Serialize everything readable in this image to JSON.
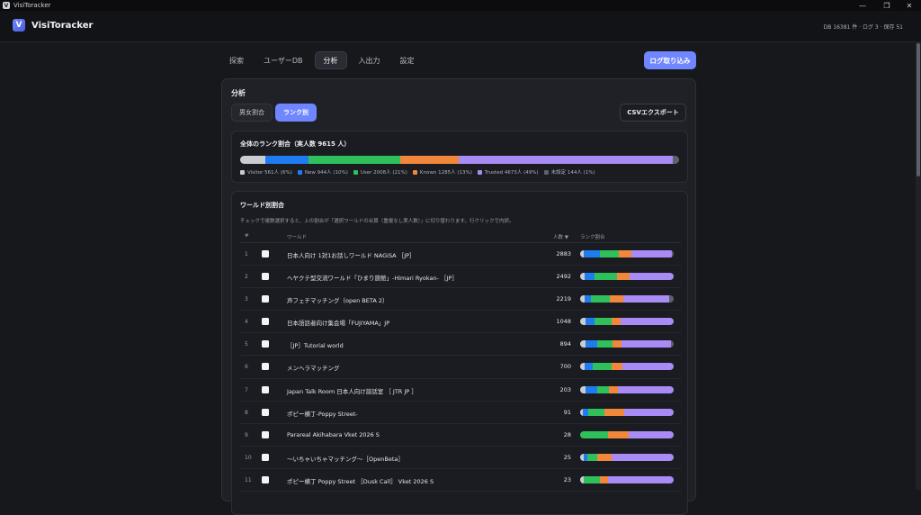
{
  "window": {
    "title": "VisiToracker",
    "minimize": "—",
    "maximize": "❐",
    "close": "✕",
    "app_icon": "V"
  },
  "header": {
    "logo": "V",
    "brand": "VisiToracker",
    "db_status": "DB 16381 件 · ログ 3 · 保存 51"
  },
  "nav": {
    "tabs": [
      {
        "label": "探索",
        "active": false
      },
      {
        "label": "ユーザーDB",
        "active": false
      },
      {
        "label": "分析",
        "active": true
      },
      {
        "label": "入出力",
        "active": false
      },
      {
        "label": "設定",
        "active": false
      }
    ],
    "import_label": "ログ取り込み"
  },
  "analysis": {
    "title": "分析",
    "subtabs": [
      {
        "label": "男女割合",
        "active": false
      },
      {
        "label": "ランク別",
        "active": true
      }
    ],
    "csv_label": "CSVエクスポート",
    "overall": {
      "title": "全体のランク割合（実人数 9615 人）",
      "segments": [
        {
          "label": "Visitor 561人 (6%)",
          "ratio": 0.058,
          "color": "#c9ccd2"
        },
        {
          "label": "New 944人 (10%)",
          "ratio": 0.098,
          "color": "#1f7cf0"
        },
        {
          "label": "User 2008人 (21%)",
          "ratio": 0.209,
          "color": "#2fbf5b"
        },
        {
          "label": "Known 1285人 (13%)",
          "ratio": 0.134,
          "color": "#f0873a"
        },
        {
          "label": "Trusted 4673人 (49%)",
          "ratio": 0.486,
          "color": "#a98bf5"
        },
        {
          "label": "未設定 144人 (1%)",
          "ratio": 0.015,
          "color": "#5d616b"
        }
      ]
    },
    "worlds": {
      "title": "ワールド別割合",
      "hint": "チェックで複数選択すると、上の割合が「選択ワールドの合算（重複なし実人数）」に切り替わります。行クリックで内訳。",
      "columns": {
        "index": "#",
        "world": "ワールド",
        "count": "人数 ▼",
        "rank": "ランク割合"
      },
      "rows": [
        {
          "index": "1",
          "name": "日本人向け 1対1お話しワールド NAGiSA ［JP］",
          "count": "2883",
          "ratios": [
            0.04,
            0.17,
            0.2,
            0.14,
            0.43,
            0.02
          ]
        },
        {
          "index": "2",
          "name": "ヘヤクテ型交流ワールド「ひまり旅館」-Himari Ryokan- ［JP］",
          "count": "2492",
          "ratios": [
            0.05,
            0.1,
            0.24,
            0.14,
            0.47,
            0.0
          ]
        },
        {
          "index": "3",
          "name": "声フェチマッチング（open BETA 2）",
          "count": "2219",
          "ratios": [
            0.05,
            0.07,
            0.2,
            0.14,
            0.49,
            0.05
          ]
        },
        {
          "index": "4",
          "name": "日本語話者向け集会場「FUJIYAMA」JP",
          "count": "1048",
          "ratios": [
            0.06,
            0.09,
            0.19,
            0.09,
            0.57,
            0.0
          ]
        },
        {
          "index": "5",
          "name": "［JP］Tutorial world",
          "count": "894",
          "ratios": [
            0.06,
            0.12,
            0.17,
            0.09,
            0.53,
            0.03
          ]
        },
        {
          "index": "6",
          "name": "メンヘラマッチング",
          "count": "700",
          "ratios": [
            0.05,
            0.08,
            0.21,
            0.11,
            0.55,
            0.0
          ]
        },
        {
          "index": "7",
          "name": "Japan Talk Room 日本人向け談話室 ［ JTR JP ］",
          "count": "203",
          "ratios": [
            0.06,
            0.12,
            0.13,
            0.09,
            0.6,
            0.0
          ]
        },
        {
          "index": "8",
          "name": "ポピー横丁-Poppy Street-",
          "count": "91",
          "ratios": [
            0.03,
            0.06,
            0.17,
            0.21,
            0.53,
            0.0
          ]
        },
        {
          "index": "9",
          "name": "Parareal Akihabara Vket 2026 S",
          "count": "28",
          "ratios": [
            0.0,
            0.0,
            0.3,
            0.22,
            0.48,
            0.0
          ]
        },
        {
          "index": "10",
          "name": "〜いちゃいちゃマッチング〜［OpenBeta］",
          "count": "25",
          "ratios": [
            0.04,
            0.04,
            0.1,
            0.16,
            0.66,
            0.0
          ]
        },
        {
          "index": "11",
          "name": "ポピー横丁 Poppy Street ［Dusk Call］ Vket 2026 S",
          "count": "23",
          "ratios": [
            0.04,
            0.0,
            0.17,
            0.09,
            0.7,
            0.0
          ]
        }
      ]
    }
  }
}
